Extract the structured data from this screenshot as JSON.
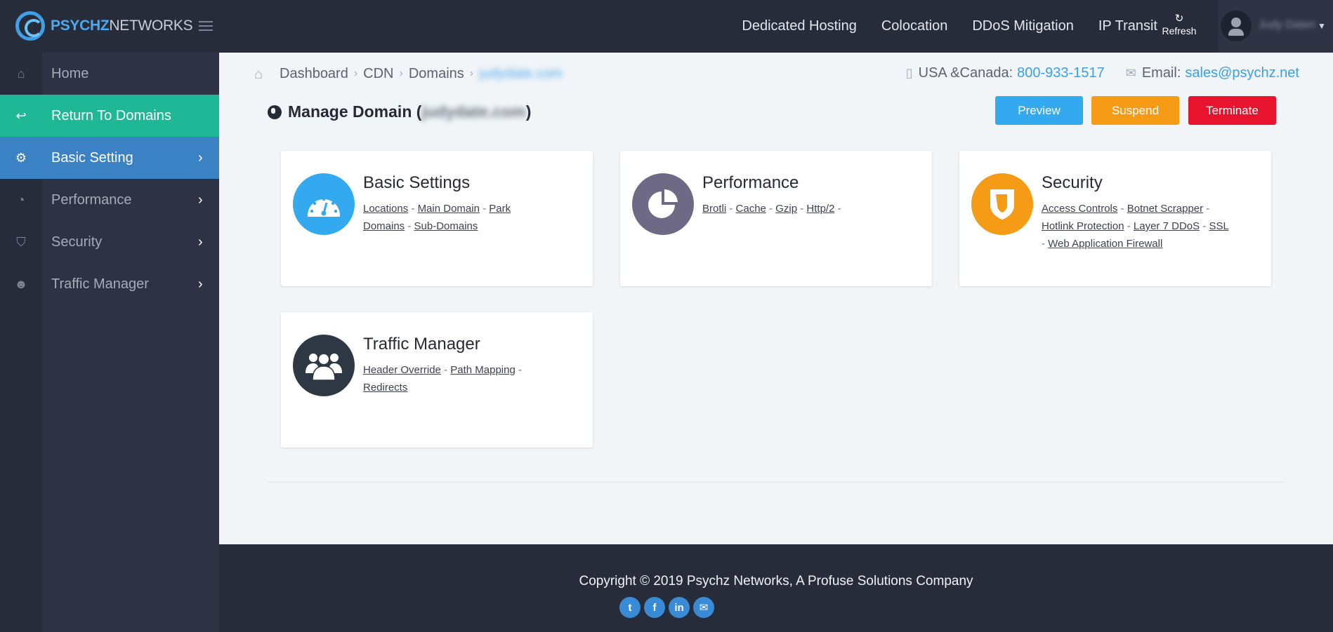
{
  "brand": {
    "name_bold": "PSYCHZ",
    "name_light": "NETWORKS"
  },
  "topnav": {
    "links": [
      "Dedicated Hosting",
      "Colocation",
      "DDoS Mitigation",
      "IP Transit"
    ],
    "refresh_label": "Refresh",
    "user_name": "Judy Daten"
  },
  "sidebar": {
    "items": [
      {
        "label": "Home",
        "icon": "home-icon"
      },
      {
        "label": "Return To Domains",
        "icon": "reply-icon"
      },
      {
        "label": "Basic Setting",
        "icon": "gear-icon"
      },
      {
        "label": "Performance",
        "icon": "pie-chart-icon"
      },
      {
        "label": "Security",
        "icon": "shield-icon"
      },
      {
        "label": "Traffic Manager",
        "icon": "users-icon"
      }
    ]
  },
  "breadcrumb": {
    "items": [
      "Dashboard",
      "CDN",
      "Domains"
    ],
    "current": "judydate.com"
  },
  "contact": {
    "phone_label": "USA &Canada:",
    "phone": "800-933-1517",
    "email_label": "Email:",
    "email": "sales@psychz.net"
  },
  "page": {
    "title_prefix": "Manage Domain (",
    "domain": "judydate.com",
    "title_suffix": ")"
  },
  "actions": {
    "preview": "Preview",
    "suspend": "Suspend",
    "terminate": "Terminate"
  },
  "cards": [
    {
      "title": "Basic Settings",
      "color": "#33aaf0",
      "icon": "speedometer-icon",
      "links": [
        "Locations",
        "Main Domain",
        "Park Domains",
        "Sub-Domains"
      ]
    },
    {
      "title": "Performance",
      "color": "#6e6a86",
      "icon": "pie-chart-icon",
      "links": [
        "Brotli",
        "Cache",
        "Gzip",
        "Http/2"
      ]
    },
    {
      "title": "Security",
      "color": "#f59b16",
      "icon": "shield-icon",
      "links": [
        "Access Controls",
        "Botnet Scrapper",
        "Hotlink Protection",
        "Layer 7 DDoS",
        "SSL",
        "Web Application Firewall"
      ]
    },
    {
      "title": "Traffic Manager",
      "color": "#2e3845",
      "icon": "users-icon",
      "links": [
        "Header Override",
        "Path Mapping",
        "Redirects"
      ]
    }
  ],
  "footer": {
    "copyright": "Copyright © 2019 Psychz Networks, A Profuse Solutions Company"
  },
  "socials": [
    "twitter-icon",
    "facebook-icon",
    "linkedin-icon",
    "email-icon"
  ]
}
